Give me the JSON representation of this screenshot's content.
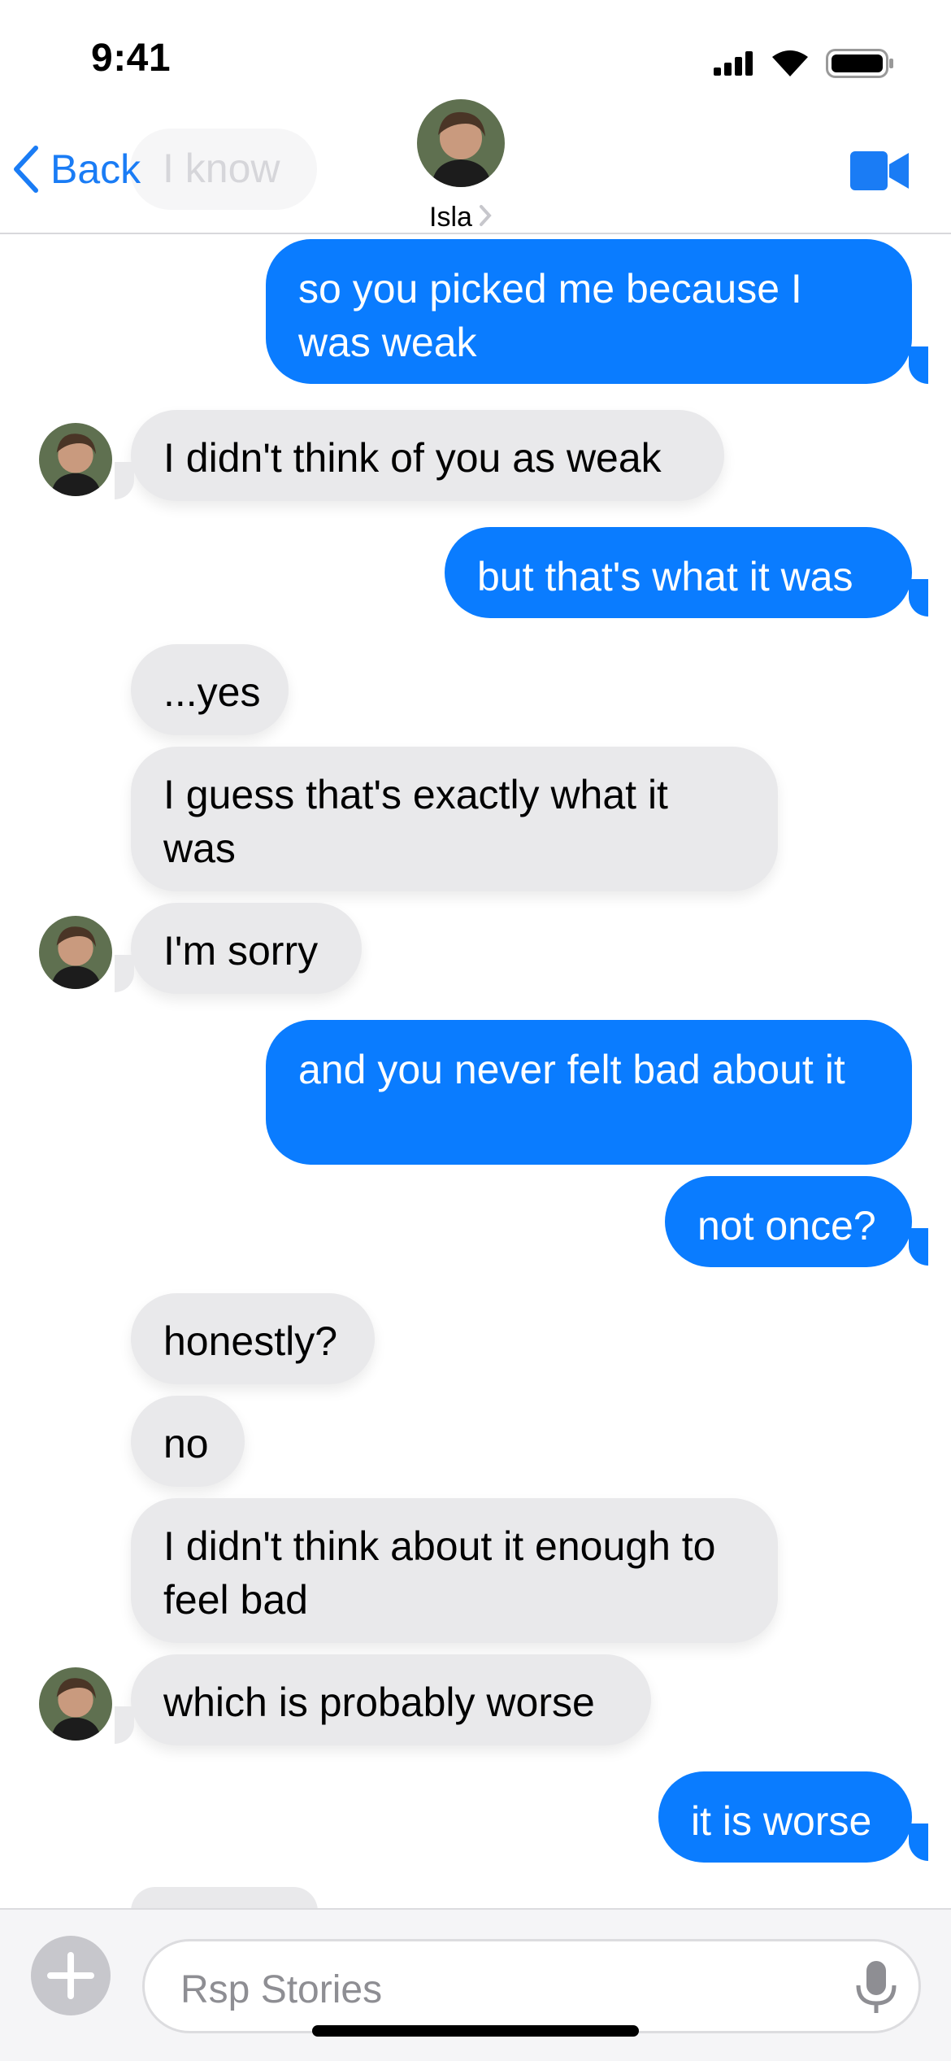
{
  "status_bar": {
    "time": "9:41"
  },
  "nav": {
    "back_label": "Back",
    "previous_preview": "I know",
    "contact_name": "Isla"
  },
  "messages": [
    {
      "side": "outgoing",
      "text": "so you picked me because I was weak"
    },
    {
      "side": "incoming",
      "text": "I didn't think of you as weak"
    },
    {
      "side": "outgoing",
      "text": "but that's what it was"
    },
    {
      "side": "incoming",
      "text": "...yes"
    },
    {
      "side": "incoming",
      "text": "I guess that's exactly what it was"
    },
    {
      "side": "incoming",
      "text": "I'm sorry"
    },
    {
      "side": "outgoing",
      "text": "and you never felt bad about it"
    },
    {
      "side": "outgoing",
      "text": "not once?"
    },
    {
      "side": "incoming",
      "text": "honestly?"
    },
    {
      "side": "incoming",
      "text": "no"
    },
    {
      "side": "incoming",
      "text": "I didn't think about it enough to feel bad"
    },
    {
      "side": "incoming",
      "text": "which is probably worse"
    },
    {
      "side": "outgoing",
      "text": "it is worse"
    }
  ],
  "composer": {
    "placeholder": "Rsp Stories"
  },
  "colors": {
    "outgoing_bubble": "#0a7cff",
    "incoming_bubble": "#e9e9eb",
    "accent": "#1a7cf5"
  },
  "icons": [
    "signal-icon",
    "wifi-icon",
    "battery-icon",
    "chevron-left-icon",
    "video-camera-icon",
    "plus-icon",
    "microphone-icon"
  ]
}
